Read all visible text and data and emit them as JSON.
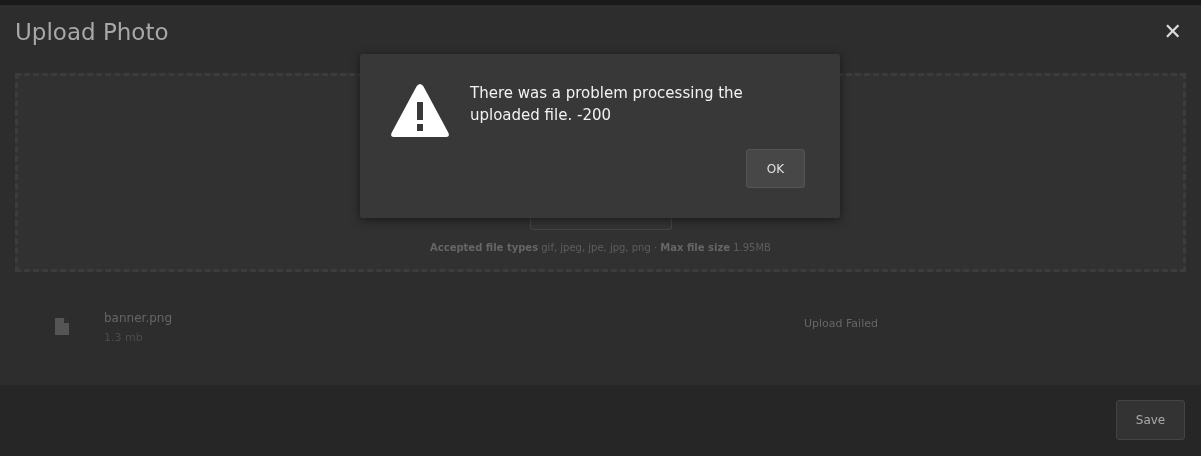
{
  "dialog": {
    "title": "Upload Photo",
    "close": "✕"
  },
  "dropzone": {
    "hint": "**Accepted file types** gif, jpeg, jpe, jpg, png · **Max file size** 1.95MB"
  },
  "files": [
    {
      "name": "banner.png",
      "size": "1.3 mb",
      "status": "Upload Failed"
    }
  ],
  "footer": {
    "buttons": [
      "Save"
    ]
  },
  "alert": {
    "message": "There was a problem processing the uploaded file. -200",
    "buttons": [
      "OK"
    ]
  }
}
